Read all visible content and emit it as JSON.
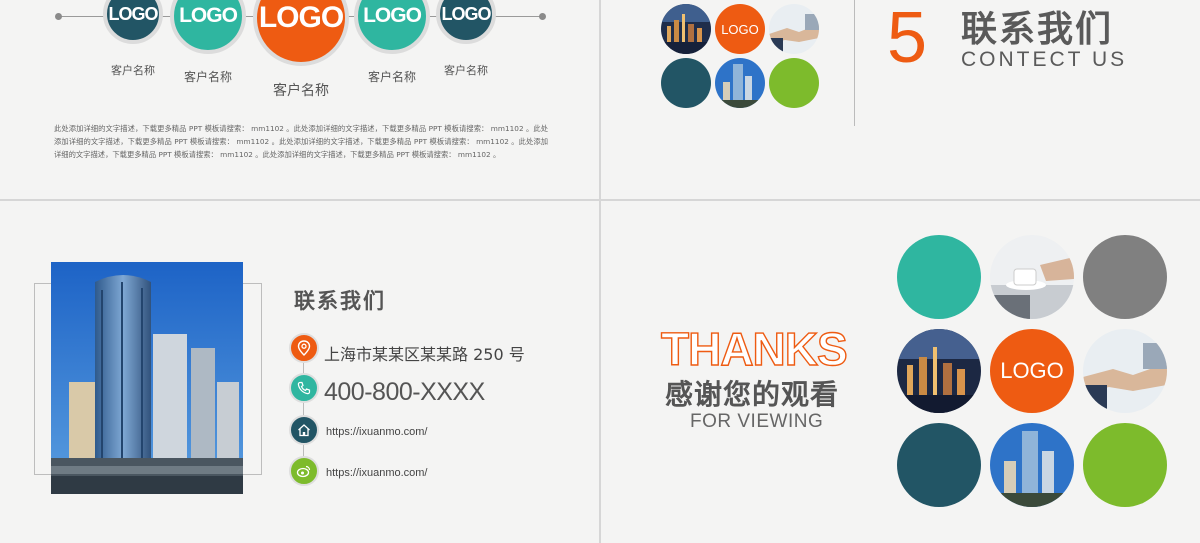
{
  "slide1": {
    "logos": [
      "LOGO",
      "LOGO",
      "LOGO",
      "LOGO",
      "LOGO"
    ],
    "client_names": [
      "客户名称",
      "客户名称",
      "客户名称",
      "客户名称",
      "客户名称"
    ],
    "paragraph": "此处添加详细的文字描述，下载更多精品 PPT 模板请搜索： mm1102 。此处添加详细的文字描述，下载更多精品 PPT 模板请搜索： mm1102 。此处添加详细的文字描述，下载更多精品 PPT 模板请搜索： mm1102 。此处添加详细的文字描述，下载更多精品 PPT 模板请搜索： mm1102 。此处添加详细的文字描述，下载更多精品 PPT 模板请搜索： mm1102 。此处添加详细的文字描述，下载更多精品 PPT 模板请搜索： mm1102 。"
  },
  "slide2": {
    "logo": "LOGO",
    "number": "5",
    "title_cn": "联系我们",
    "title_en": "CONTECT US"
  },
  "slide3": {
    "title": "联系我们",
    "address": "上海市某某区某某路 250 号",
    "phone": "400-800-XXXX",
    "website": "https://ixuanmo.com/",
    "weibo": "https://ixuanmo.com/",
    "icons": [
      "location-pin-icon",
      "phone-icon",
      "home-icon",
      "weibo-icon"
    ]
  },
  "slide4": {
    "thanks": "THANKS",
    "thanks_cn": "感谢您的观看",
    "thanks_en": "FOR VIEWING",
    "logo": "LOGO"
  },
  "colors": {
    "orange": "#ee5b12",
    "teal": "#2fb6a0",
    "dark_teal": "#225565",
    "green": "#7dbb2c",
    "gray": "#808080"
  }
}
